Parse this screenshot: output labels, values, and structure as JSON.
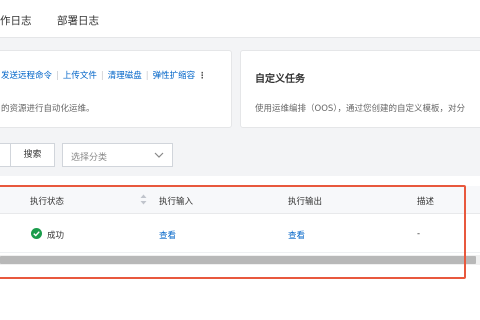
{
  "tabs": [
    {
      "label": "作日志"
    },
    {
      "label": "部署日志"
    }
  ],
  "quick_actions": {
    "links": [
      {
        "label": "发送远程命令"
      },
      {
        "label": "上传文件"
      },
      {
        "label": "清理磁盘"
      },
      {
        "label": "弹性扩缩容"
      }
    ],
    "more_icon": "⋮",
    "description": "的资源进行自动化运维。"
  },
  "custom_task": {
    "title": "自定义任务",
    "description": "使用运维编排（OOS），通过您创建的自定义模板，对分"
  },
  "filter": {
    "search_button": "搜索",
    "category_placeholder": "选择分类"
  },
  "table": {
    "columns": [
      "执行状态",
      "执行输入",
      "执行输出",
      "描述"
    ],
    "rows": [
      {
        "status": "成功",
        "input": "查看",
        "output": "查看",
        "description": "-"
      }
    ]
  },
  "colors": {
    "link": "#0064c8",
    "success": "#1a9c4b",
    "highlight": "#e8583d"
  }
}
